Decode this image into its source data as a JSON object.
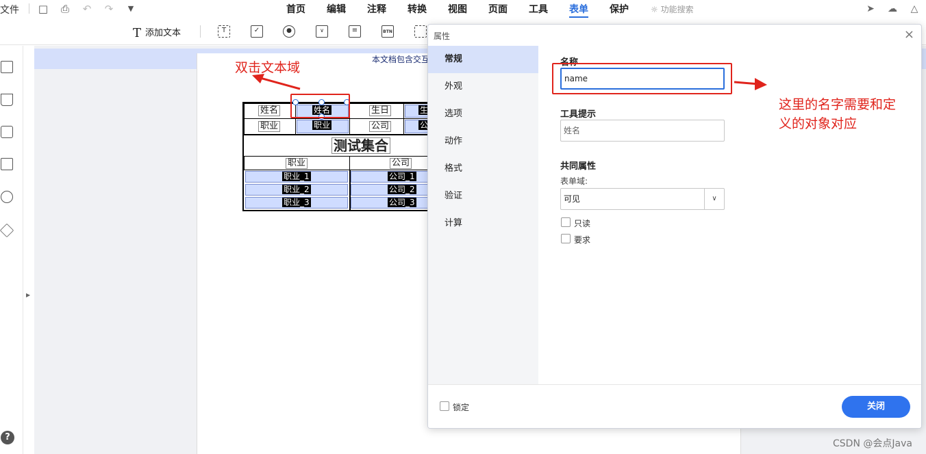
{
  "menubar": {
    "file": "文件",
    "tabs": [
      "首页",
      "编辑",
      "注释",
      "转换",
      "视图",
      "页面",
      "工具",
      "表单",
      "保护"
    ],
    "active_tab": "表单",
    "search_hint": "功能搜索"
  },
  "toolbar": {
    "add_text": "添加文本",
    "form_tools": [
      "text-field-icon",
      "checkbox-icon",
      "radio-icon",
      "dropdown-icon",
      "listbox-icon",
      "button-icon",
      "image-field-icon"
    ],
    "btn_glyph": "BTN"
  },
  "document": {
    "info_banner": "本文档包含交互",
    "labels": {
      "name": "姓名",
      "birth": "生日",
      "job": "职业",
      "company": "公司",
      "birth_partial": "生",
      "company_partial": "公"
    },
    "title": "测试集合",
    "header_job": "职业",
    "header_company": "公司",
    "rows": [
      {
        "job": "职业_1",
        "company": "公司_1"
      },
      {
        "job": "职业_2",
        "company": "公司_2"
      },
      {
        "job": "职业_3",
        "company": "公司_3"
      }
    ]
  },
  "annotations": {
    "double_click": "双击文本域",
    "name_note_line1": "这里的名字需要和定",
    "name_note_line2": "义的对象对应",
    "color": "#e0241c"
  },
  "dialog": {
    "title": "属性",
    "close_glyph": "×",
    "sidebar": [
      "常规",
      "外观",
      "选项",
      "动作",
      "格式",
      "验证",
      "计算"
    ],
    "active_section": "常规",
    "name_label": "名称",
    "name_value": "name",
    "tooltip_label": "工具提示",
    "tooltip_value": "姓名",
    "common_label": "共同属性",
    "form_field_label": "表单域:",
    "visibility_value": "可见",
    "readonly_label": "只读",
    "required_label": "要求",
    "lock_label": "锁定",
    "close_button": "关闭",
    "accent": "#2f73ee"
  },
  "watermark": "CSDN @会点Java"
}
